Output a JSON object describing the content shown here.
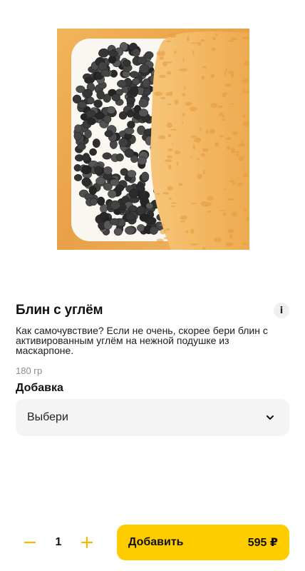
{
  "product": {
    "title": "Блин с углём",
    "info_icon": "i",
    "description": "Как самочувствие? Если не очень, скорее бери блин с активированным углём на нежной подушке из маскарпоне.",
    "weight": "180 гр",
    "image_icon": "pancake-with-charcoal-photo"
  },
  "addon": {
    "label": "Добавка",
    "selected": "Выбери",
    "icon": "chevron-down-icon"
  },
  "cart": {
    "minus_icon": "minus-icon",
    "quantity": "1",
    "plus_icon": "plus-icon",
    "add_label": "Добавить",
    "price": "595 ₽"
  },
  "colors": {
    "accent": "#ffcc00",
    "field_bg": "#f4f4f4",
    "muted_text": "#8a8a8a"
  }
}
